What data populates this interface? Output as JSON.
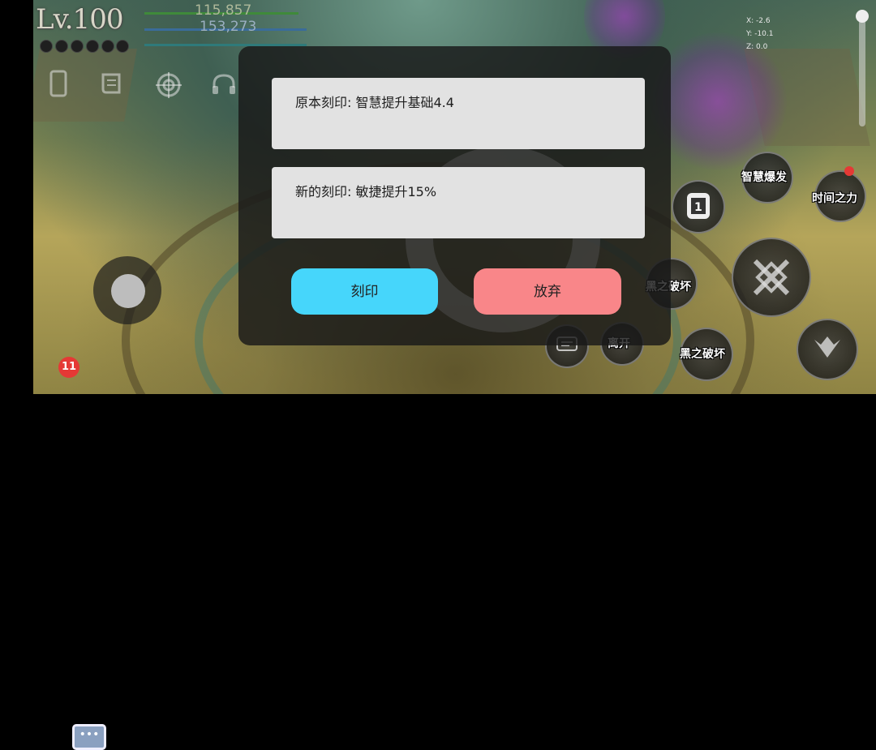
{
  "hud": {
    "level": "Lv.100",
    "hp": "115,857",
    "mp": "153,273",
    "coords": {
      "x": "X: -2.6",
      "y": "Y: -10.1",
      "z": "Z: 0.0"
    },
    "icons": [
      "phone-icon",
      "scroll-icon",
      "target-icon",
      "headset-icon"
    ]
  },
  "skills": {
    "wisdom_burst": "智慧爆发",
    "time_power": "时间之力",
    "dark_break_1": "黑之破坏",
    "dark_break_2": "黑之破坏",
    "leave": "离开",
    "slot_number": "1"
  },
  "chat": {
    "badge": "11",
    "glyph": "•••"
  },
  "dialog": {
    "original_engraving": "原本刻印: 智慧提升基础4.4",
    "new_engraving": "新的刻印: 敏捷提升15%",
    "engrave_button": "刻印",
    "abandon_button": "放弃"
  },
  "colors": {
    "engrave_button": "#46d6fb",
    "abandon_button": "#f98689",
    "text_box": "#e2e2e2",
    "badge": "#e53935"
  }
}
